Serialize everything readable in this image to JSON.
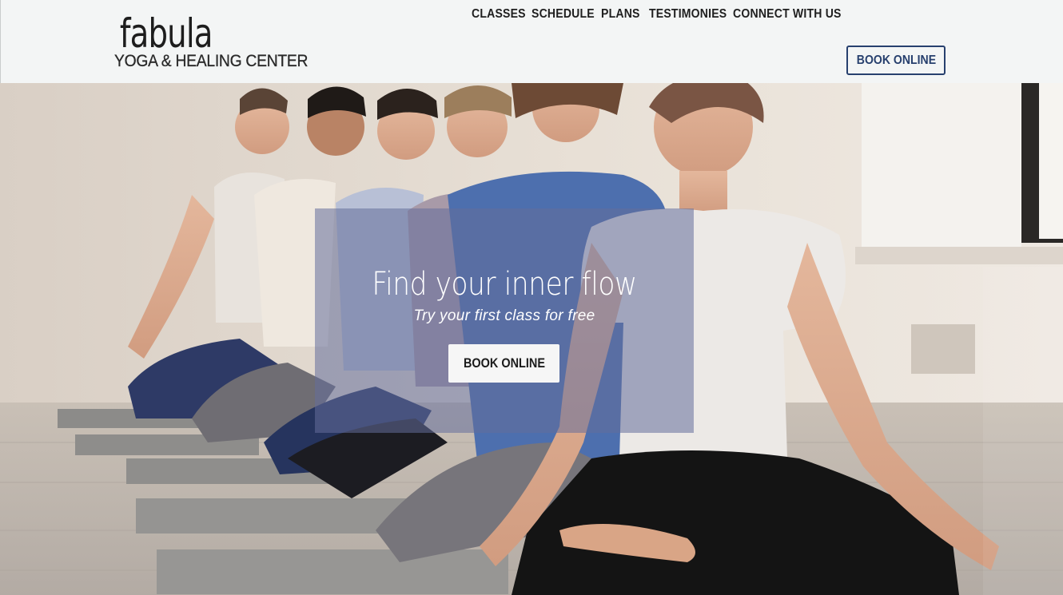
{
  "brand": {
    "name": "fabula",
    "tagline": "YOGA & HEALING CENTER"
  },
  "nav": {
    "items": [
      {
        "label": "CLASSES"
      },
      {
        "label": "SCHEDULE"
      },
      {
        "label": "PLANS"
      },
      {
        "label": "TESTIMONIES"
      },
      {
        "label": "CONNECT WITH US"
      }
    ],
    "book_label": "BOOK ONLINE"
  },
  "hero": {
    "title": "Find your inner flow",
    "subtitle": "Try your first class for free",
    "button_label": "BOOK ONLINE",
    "image_subject": "group-yoga-meditation-photo"
  },
  "colors": {
    "header_bg": "#f3f5f5",
    "accent": "#27406e",
    "overlay": "#646e9b"
  }
}
